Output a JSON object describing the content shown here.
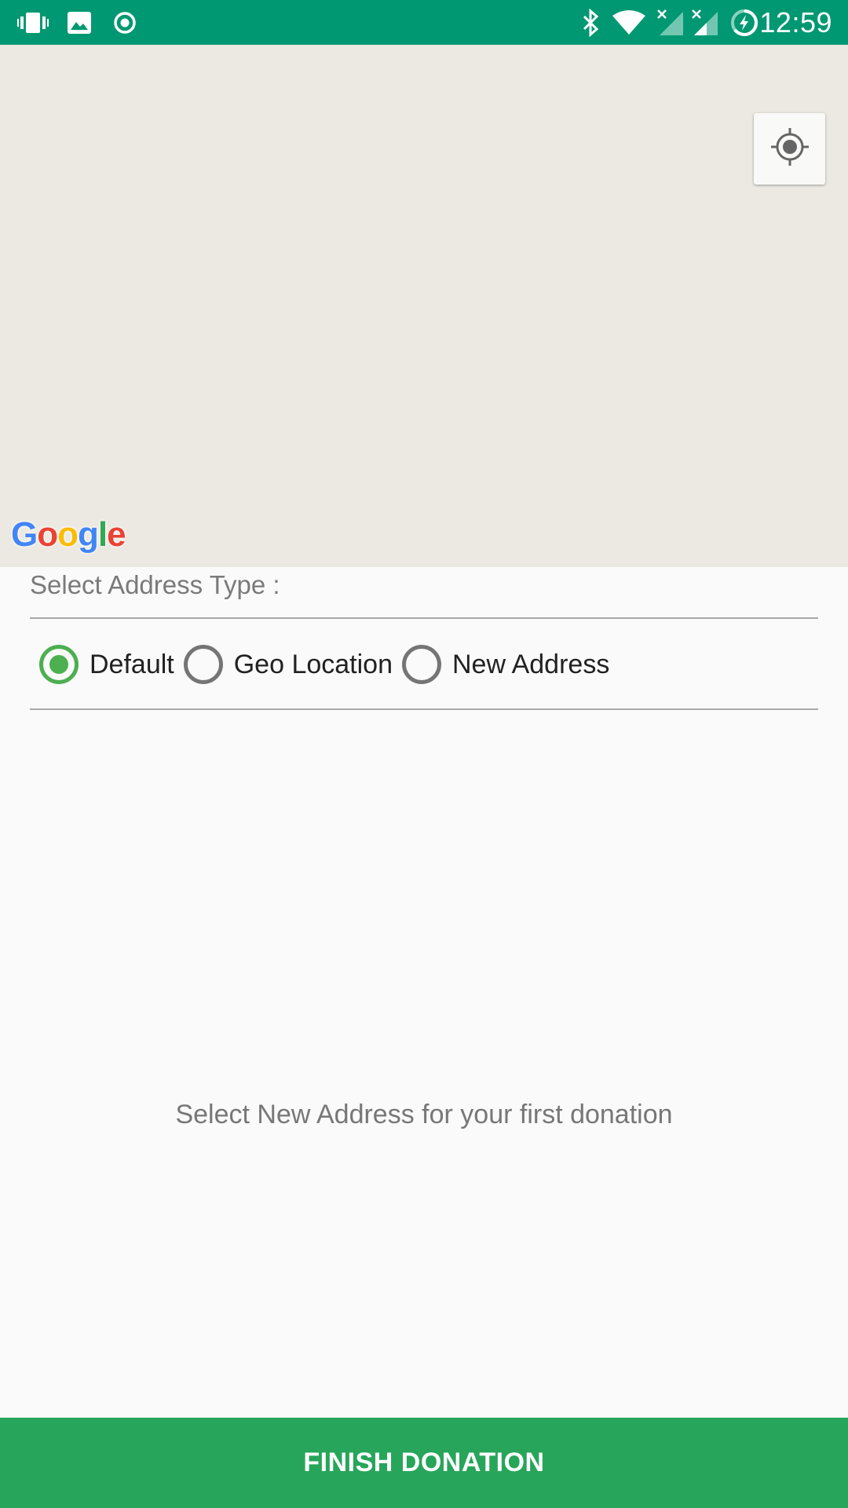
{
  "status_bar": {
    "time": "12:59",
    "left_icons": [
      "vibrate-icon",
      "image-icon",
      "record-icon"
    ],
    "right_icons": [
      "bluetooth-icon",
      "wifi-icon",
      "signal-1-icon",
      "signal-2-icon",
      "battery-charging-icon"
    ],
    "background_color": "#009872"
  },
  "map": {
    "locate_button_icon": "my-location-icon",
    "logo": "Google"
  },
  "address_type": {
    "label": "Select Address Type :",
    "options": [
      {
        "label": "Default",
        "checked": true
      },
      {
        "label": "Geo Location",
        "checked": false
      },
      {
        "label": "New Address",
        "checked": false
      }
    ]
  },
  "info_text": "Select New Address for your first donation",
  "finish_button": {
    "label": "FINISH DONATION",
    "color": "#27a55a"
  },
  "accent_color": "#4caf50"
}
